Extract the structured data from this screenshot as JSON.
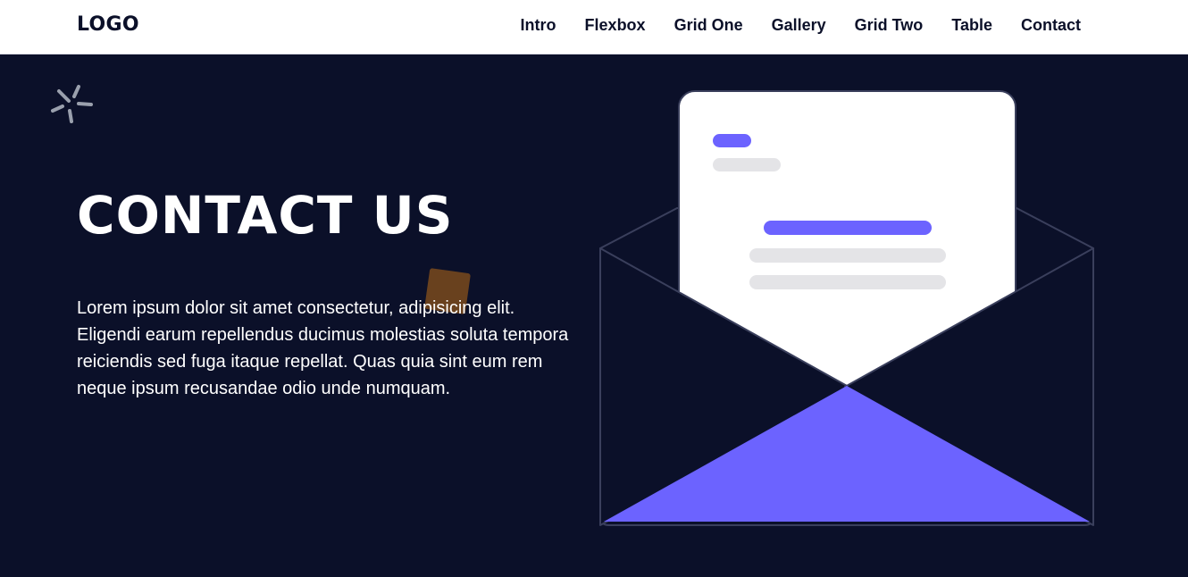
{
  "header": {
    "logo": "LOGO",
    "nav": [
      "Intro",
      "Flexbox",
      "Grid One",
      "Gallery",
      "Grid Two",
      "Table",
      "Contact"
    ]
  },
  "hero": {
    "title": "CONTACT US",
    "description": "Lorem ipsum dolor sit amet consectetur, adipisicing elit. Eligendi earum repellendus ducimus molestias soluta tempora reiciendis sed fuga itaque repellat. Quas quia sint eum rem neque ipsum recusandae odio unde numquam."
  },
  "icons": {
    "sparkle": "sparkle-icon",
    "illustration": "envelope-letter-icon"
  },
  "colors": {
    "background": "#0b1029",
    "accent": "#6c63ff",
    "letter": "#ffffff",
    "placeholder_line": "#e4e4e7",
    "decorative_square": "#7a4a1c"
  }
}
